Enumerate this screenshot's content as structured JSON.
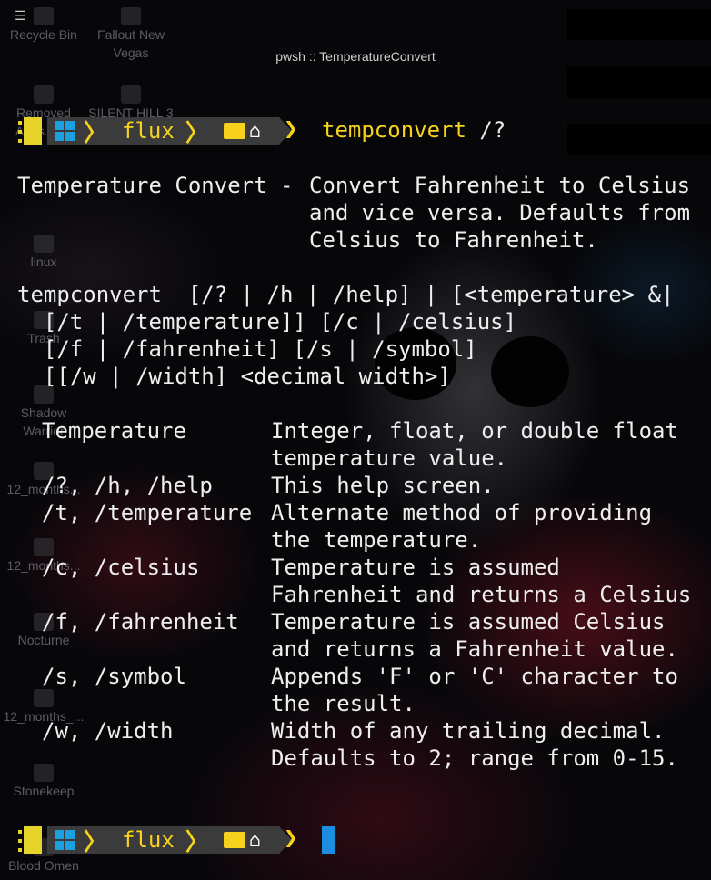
{
  "window": {
    "title": "pwsh :: TemperatureConvert",
    "menu_icon": "hamburger-icon"
  },
  "desktop_icons": [
    {
      "label": "Recycle Bin",
      "icon": "recycle-bin-icon"
    },
    {
      "label": "Fallout New Vegas",
      "icon": "game-icon"
    },
    {
      "label": "Removed Apps.html",
      "icon": "browser-icon"
    },
    {
      "label": "SILENT HILL 3",
      "icon": "game-icon"
    },
    {
      "label": "linux",
      "icon": "folder-icon"
    },
    {
      "label": "Trash",
      "icon": "trash-icon"
    },
    {
      "label": "Shadow Warrior",
      "icon": "game-icon"
    },
    {
      "label": "12_months...",
      "icon": "audio-file-icon"
    },
    {
      "label": "12_months...",
      "icon": "audio-file-icon"
    },
    {
      "label": "Nocturne",
      "icon": "game-icon"
    },
    {
      "label": "12_months_...",
      "icon": "audio-file-icon"
    },
    {
      "label": "Stonekeep",
      "icon": "game-icon"
    },
    {
      "label": "Blood Omen",
      "icon": "game-icon"
    }
  ],
  "prompt": {
    "dir": "flux",
    "command": "tempconvert",
    "args": "/?",
    "symbol": "❯",
    "accent": "#f6d21c",
    "cursor_color": "#1c8de0"
  },
  "help": {
    "name": "Temperature Convert -",
    "desc": [
      "Convert Fahrenheit to Celsius",
      "and vice versa. Defaults from",
      "Celsius to Fahrenheit."
    ],
    "usage": [
      "tempconvert  [/? | /h | /help] | [<temperature> &|",
      "  [/t | /temperature]] [/c | /celsius]",
      "  [/f | /fahrenheit] [/s | /symbol]",
      "  [[/w | /width] <decimal width>]"
    ],
    "options": [
      {
        "flag": "Temperature",
        "desc": [
          "Integer, float, or double float",
          "temperature value."
        ]
      },
      {
        "flag": "/?, /h, /help",
        "desc": [
          "This help screen."
        ]
      },
      {
        "flag": "/t, /temperature",
        "desc": [
          "Alternate method of providing",
          "the temperature."
        ]
      },
      {
        "flag": "/c, /celsius",
        "desc": [
          "Temperature is assumed",
          "Fahrenheit and returns a Celsius"
        ]
      },
      {
        "flag": "/f, /fahrenheit",
        "desc": [
          "Temperature is assumed Celsius",
          "and returns a Fahrenheit value."
        ]
      },
      {
        "flag": "/s, /symbol",
        "desc": [
          "Appends 'F' or 'C' character to",
          "the result."
        ]
      },
      {
        "flag": "/w, /width",
        "desc": [
          "Width of any trailing decimal.",
          "Defaults to 2; range from 0-15."
        ]
      }
    ]
  }
}
